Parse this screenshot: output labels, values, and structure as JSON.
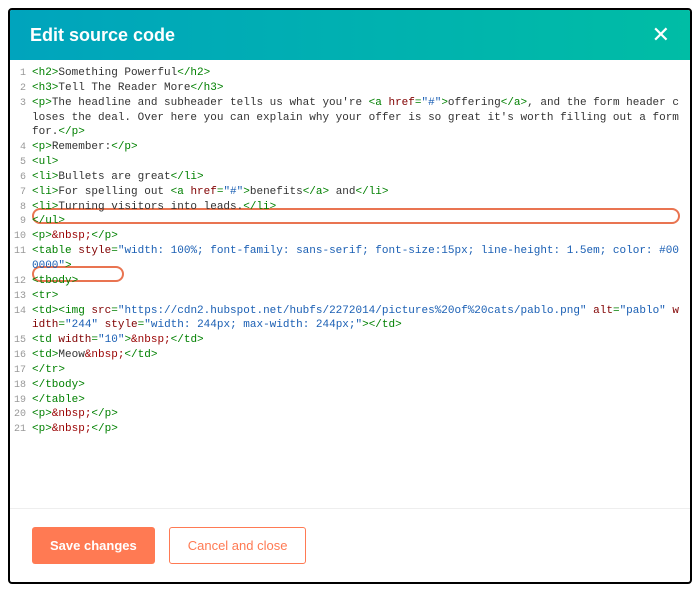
{
  "header": {
    "title": "Edit source code",
    "close_label": "✕"
  },
  "code": {
    "lines": [
      {
        "num": "1",
        "segs": [
          {
            "c": "t-tag",
            "t": "<h2>"
          },
          {
            "c": "t-txt",
            "t": "Something Powerful"
          },
          {
            "c": "t-tag",
            "t": "</h2>"
          }
        ]
      },
      {
        "num": "2",
        "segs": [
          {
            "c": "t-tag",
            "t": "<h3>"
          },
          {
            "c": "t-txt",
            "t": "Tell The Reader More"
          },
          {
            "c": "t-tag",
            "t": "</h3>"
          }
        ]
      },
      {
        "num": "3",
        "segs": [
          {
            "c": "t-tag",
            "t": "<p>"
          },
          {
            "c": "t-txt",
            "t": "The headline and subheader tells us what you're "
          },
          {
            "c": "t-tag",
            "t": "<a "
          },
          {
            "c": "t-attr",
            "t": "href"
          },
          {
            "c": "t-tag",
            "t": "="
          },
          {
            "c": "t-str",
            "t": "\"#\""
          },
          {
            "c": "t-tag",
            "t": ">"
          },
          {
            "c": "t-txt",
            "t": "offering"
          },
          {
            "c": "t-tag",
            "t": "</a>"
          },
          {
            "c": "t-txt",
            "t": ", and the form header closes the deal. Over here you can explain why your offer is so great it's worth filling out a form for."
          },
          {
            "c": "t-tag",
            "t": "</p>"
          }
        ]
      },
      {
        "num": "4",
        "segs": [
          {
            "c": "t-tag",
            "t": "<p>"
          },
          {
            "c": "t-txt",
            "t": "Remember:"
          },
          {
            "c": "t-tag",
            "t": "</p>"
          }
        ]
      },
      {
        "num": "5",
        "segs": [
          {
            "c": "t-tag",
            "t": "<ul>"
          }
        ]
      },
      {
        "num": "6",
        "segs": [
          {
            "c": "t-tag",
            "t": "<li>"
          },
          {
            "c": "t-txt",
            "t": "Bullets are great"
          },
          {
            "c": "t-tag",
            "t": "</li>"
          }
        ]
      },
      {
        "num": "7",
        "segs": [
          {
            "c": "t-tag",
            "t": "<li>"
          },
          {
            "c": "t-txt",
            "t": "For spelling out "
          },
          {
            "c": "t-tag",
            "t": "<a "
          },
          {
            "c": "t-attr",
            "t": "href"
          },
          {
            "c": "t-tag",
            "t": "="
          },
          {
            "c": "t-str",
            "t": "\"#\""
          },
          {
            "c": "t-tag",
            "t": ">"
          },
          {
            "c": "t-txt",
            "t": "benefits"
          },
          {
            "c": "t-tag",
            "t": "</a>"
          },
          {
            "c": "t-txt",
            "t": " and"
          },
          {
            "c": "t-tag",
            "t": "</li>"
          }
        ]
      },
      {
        "num": "8",
        "segs": [
          {
            "c": "t-tag",
            "t": "<li>"
          },
          {
            "c": "t-txt",
            "t": "Turning visitors into leads."
          },
          {
            "c": "t-tag",
            "t": "</li>"
          }
        ]
      },
      {
        "num": "9",
        "segs": [
          {
            "c": "t-tag",
            "t": "</ul>"
          }
        ]
      },
      {
        "num": "10",
        "segs": [
          {
            "c": "t-tag",
            "t": "<p>"
          },
          {
            "c": "t-ent",
            "t": "&nbsp;"
          },
          {
            "c": "t-tag",
            "t": "</p>"
          }
        ]
      },
      {
        "num": "11",
        "segs": [
          {
            "c": "t-tag",
            "t": "<table "
          },
          {
            "c": "t-attr",
            "t": "style"
          },
          {
            "c": "t-tag",
            "t": "="
          },
          {
            "c": "t-str",
            "t": "\"width: 100%; font-family: sans-serif; font-size:15px; line-height: 1.5em; color: #000000\""
          },
          {
            "c": "t-tag",
            "t": ">"
          }
        ]
      },
      {
        "num": "12",
        "segs": [
          {
            "c": "t-tag",
            "t": "<tbody>"
          }
        ]
      },
      {
        "num": "13",
        "segs": [
          {
            "c": "t-tag",
            "t": "<tr>"
          }
        ]
      },
      {
        "num": "14",
        "segs": [
          {
            "c": "t-tag",
            "t": "<td><img "
          },
          {
            "c": "t-attr",
            "t": "src"
          },
          {
            "c": "t-tag",
            "t": "="
          },
          {
            "c": "t-str",
            "t": "\"https://cdn2.hubspot.net/hubfs/2272014/pictures%20of%20cats/pablo.png\""
          },
          {
            "c": "t-tag",
            "t": " "
          },
          {
            "c": "t-attr",
            "t": "alt"
          },
          {
            "c": "t-tag",
            "t": "="
          },
          {
            "c": "t-str",
            "t": "\"pablo\""
          },
          {
            "c": "t-tag",
            "t": " "
          },
          {
            "c": "t-attr",
            "t": "width"
          },
          {
            "c": "t-tag",
            "t": "="
          },
          {
            "c": "t-str",
            "t": "\"244\""
          },
          {
            "c": "t-tag",
            "t": " "
          },
          {
            "c": "t-attr",
            "t": "style"
          },
          {
            "c": "t-tag",
            "t": "="
          },
          {
            "c": "t-str",
            "t": "\"width: 244px; max-width: 244px;\""
          },
          {
            "c": "t-tag",
            "t": "></td>"
          }
        ]
      },
      {
        "num": "15",
        "segs": [
          {
            "c": "t-tag",
            "t": "<td "
          },
          {
            "c": "t-attr",
            "t": "width"
          },
          {
            "c": "t-tag",
            "t": "="
          },
          {
            "c": "t-str",
            "t": "\"10\""
          },
          {
            "c": "t-tag",
            "t": ">"
          },
          {
            "c": "t-ent",
            "t": "&nbsp;"
          },
          {
            "c": "t-tag",
            "t": "</td>"
          }
        ]
      },
      {
        "num": "16",
        "segs": [
          {
            "c": "t-tag",
            "t": "<td>"
          },
          {
            "c": "t-txt",
            "t": "Meow"
          },
          {
            "c": "t-ent",
            "t": "&nbsp;"
          },
          {
            "c": "t-tag",
            "t": "</td>"
          }
        ]
      },
      {
        "num": "17",
        "segs": [
          {
            "c": "t-tag",
            "t": "</tr>"
          }
        ]
      },
      {
        "num": "18",
        "segs": [
          {
            "c": "t-tag",
            "t": "</tbody>"
          }
        ]
      },
      {
        "num": "19",
        "segs": [
          {
            "c": "t-tag",
            "t": "</table>"
          }
        ]
      },
      {
        "num": "20",
        "segs": [
          {
            "c": "t-tag",
            "t": "<p>"
          },
          {
            "c": "t-ent",
            "t": "&nbsp;"
          },
          {
            "c": "t-tag",
            "t": "</p>"
          }
        ]
      },
      {
        "num": "21",
        "segs": [
          {
            "c": "t-tag",
            "t": "<p>"
          },
          {
            "c": "t-ent",
            "t": "&nbsp;"
          },
          {
            "c": "t-tag",
            "t": "</p>"
          }
        ]
      }
    ]
  },
  "buttons": {
    "save": "Save changes",
    "cancel": "Cancel and close"
  }
}
